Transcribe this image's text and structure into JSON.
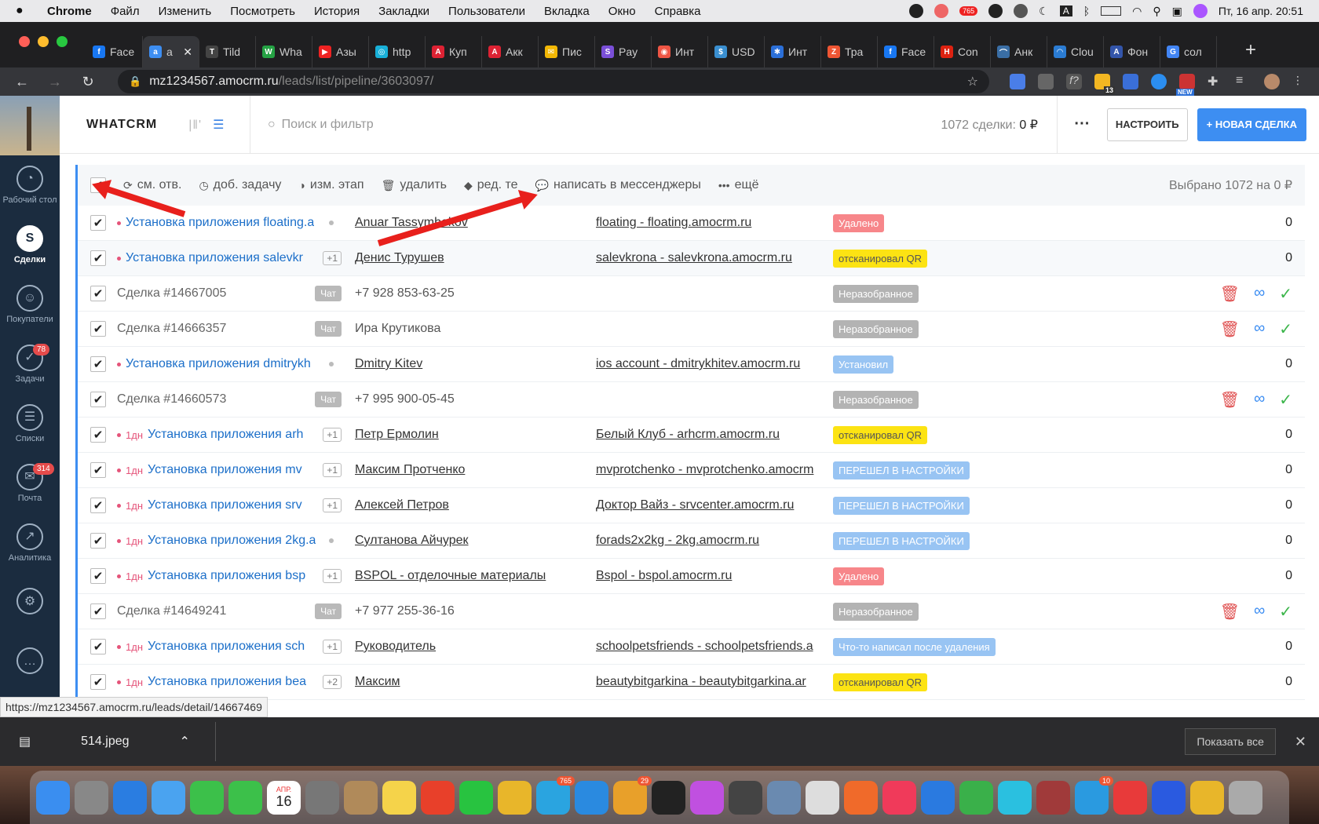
{
  "menubar": {
    "app": "Chrome",
    "items": [
      "Файл",
      "Изменить",
      "Посмотреть",
      "История",
      "Закладки",
      "Пользователи",
      "Вкладка",
      "Окно",
      "Справка"
    ],
    "badge": "765",
    "datetime": "Пт, 16 апр.  20:51"
  },
  "browser": {
    "tabs": [
      {
        "label": "Face",
        "color": "#1877f2",
        "glyph": "f"
      },
      {
        "label": "a",
        "color": "#3d8ef2",
        "glyph": "a",
        "active": true
      },
      {
        "label": "Tild",
        "color": "#444",
        "glyph": "T"
      },
      {
        "label": "Wha",
        "color": "#25a244",
        "glyph": "W"
      },
      {
        "label": "Азы",
        "color": "#e22",
        "glyph": "▶"
      },
      {
        "label": "http",
        "color": "#18b0d8",
        "glyph": "◎"
      },
      {
        "label": "Куп",
        "color": "#d23",
        "glyph": "A"
      },
      {
        "label": "Акк",
        "color": "#d23",
        "glyph": "A"
      },
      {
        "label": "Пис",
        "color": "#f2b705",
        "glyph": "✉"
      },
      {
        "label": "Pay",
        "color": "#7a4fd8",
        "glyph": "S"
      },
      {
        "label": "Инт",
        "color": "#e54",
        "glyph": "◉"
      },
      {
        "label": "USD",
        "color": "#3a8fd0",
        "glyph": "$"
      },
      {
        "label": "Инт",
        "color": "#2b6fd8",
        "glyph": "✱"
      },
      {
        "label": "Тра",
        "color": "#e53",
        "glyph": "Z"
      },
      {
        "label": "Face",
        "color": "#1877f2",
        "glyph": "f"
      },
      {
        "label": "Con",
        "color": "#d21",
        "glyph": "H"
      },
      {
        "label": "Анк",
        "color": "#3a6ea5",
        "glyph": "⌒"
      },
      {
        "label": "Clou",
        "color": "#2b7cd3",
        "glyph": "◠"
      },
      {
        "label": "Фон",
        "color": "#3355aa",
        "glyph": "A"
      },
      {
        "label": "сол",
        "color": "#4285f4",
        "glyph": "G"
      }
    ],
    "url_host": "mz1234567.amocrm.ru",
    "url_path": "/leads/list/pipeline/3603097/",
    "ext_badge_count": "13",
    "ext_badge_new": "NEW"
  },
  "leftnav": {
    "items": [
      {
        "label": "Рабочий стол",
        "icon": "dashboard-icon",
        "glyph": "◔"
      },
      {
        "label": "Сделки",
        "icon": "deals-icon",
        "glyph": "S",
        "active": true
      },
      {
        "label": "Покупатели",
        "icon": "customers-icon",
        "glyph": "☺"
      },
      {
        "label": "Задачи",
        "icon": "tasks-icon",
        "glyph": "✓",
        "badge": "78"
      },
      {
        "label": "Списки",
        "icon": "lists-icon",
        "glyph": "☰"
      },
      {
        "label": "Почта",
        "icon": "mail-icon",
        "glyph": "✉",
        "badge": "314"
      },
      {
        "label": "Аналитика",
        "icon": "analytics-icon",
        "glyph": "↗"
      },
      {
        "label": "",
        "icon": "settings-icon",
        "glyph": "⚙"
      },
      {
        "label": "",
        "icon": "chat-icon",
        "glyph": "…"
      }
    ]
  },
  "header": {
    "brand": "WHATCRM",
    "search_placeholder": "Поиск и фильтр",
    "count_label": "1072 сделки:",
    "count_value": "0 ₽",
    "more": "···",
    "setup_button": "НАСТРОИТЬ",
    "new_button": "+ НОВАЯ СДЕЛКА"
  },
  "toolbar": {
    "actions": [
      {
        "label": "см. отв.",
        "icon": "change-responsible-icon",
        "glyph": "⟳"
      },
      {
        "label": "доб. задачу",
        "icon": "add-task-icon",
        "glyph": "◷"
      },
      {
        "label": "изм. этап",
        "icon": "change-stage-icon",
        "glyph": "◑"
      },
      {
        "label": "удалить",
        "icon": "trash-icon",
        "glyph": "🗑"
      },
      {
        "label": "ред. те",
        "icon": "tag-icon",
        "glyph": "◆"
      },
      {
        "label": "написать в мессенджеры",
        "icon": "messenger-icon",
        "glyph": "💬"
      },
      {
        "label": "ещё",
        "icon": "more-icon",
        "glyph": "•••"
      }
    ],
    "selected": "Выбрано 1072 на 0 ₽"
  },
  "rows": [
    {
      "name": "Установка приложения floating.a",
      "dot": true,
      "age": "",
      "kind": "gdot",
      "contact": "Anuar Tassymbekov",
      "company": "floating - floating.amocrm.ru",
      "status": "Удалено",
      "status_class": "st-del",
      "budget": "0"
    },
    {
      "name": "Установка приложения salevkr",
      "dot": true,
      "age": "",
      "kind": "plus",
      "extra": "+1",
      "contact": "Денис Турушев",
      "company": "salevkrona - salevkrona.amocrm.ru",
      "status": "отсканировал QR",
      "status_class": "st-qr",
      "budget": "0"
    },
    {
      "name": "Сделка #14667005",
      "dot": false,
      "age": "",
      "kind": "chip",
      "extra": "Чат",
      "contact": "+7 928 853-63-25",
      "plain": true,
      "company": "",
      "status": "Неразобранное",
      "status_class": "st-unsorted",
      "actions": true
    },
    {
      "name": "Сделка #14666357",
      "dot": false,
      "age": "",
      "kind": "chip",
      "extra": "Чат",
      "contact": "Ира Крутикова",
      "plain": true,
      "company": "",
      "status": "Неразобранное",
      "status_class": "st-unsorted",
      "actions": true
    },
    {
      "name": "Установка приложения dmitrykh",
      "dot": true,
      "age": "",
      "kind": "gdot",
      "contact": "Dmitry Kitev",
      "company": "ios account - dmitrykhitev.amocrm.ru",
      "status": "Установил",
      "status_class": "st-inst",
      "budget": "0"
    },
    {
      "name": "Сделка #14660573",
      "dot": false,
      "age": "",
      "kind": "chip",
      "extra": "Чат",
      "contact": "+7 995 900-05-45",
      "plain": true,
      "company": "",
      "status": "Неразобранное",
      "status_class": "st-unsorted",
      "actions": true
    },
    {
      "name": "Установка приложения arh",
      "dot": true,
      "age": "1дн",
      "kind": "plus",
      "extra": "+1",
      "contact": "Петр Ермолин",
      "company": "Белый Клуб - arhcrm.amocrm.ru",
      "status": "отсканировал QR",
      "status_class": "st-qr",
      "budget": "0"
    },
    {
      "name": "Установка приложения mv",
      "dot": true,
      "age": "1дн",
      "kind": "plus",
      "extra": "+1",
      "contact": "Максим Протченко",
      "company": "mvprotchenko - mvprotchenko.amocrm",
      "status": "ПЕРЕШЕЛ В НАСТРОЙКИ",
      "status_class": "st-settings",
      "budget": "0"
    },
    {
      "name": "Установка приложения srv",
      "dot": true,
      "age": "1дн",
      "kind": "plus",
      "extra": "+1",
      "contact": "Алексей Петров",
      "company": "Доктор Вайз - srvcenter.amocrm.ru",
      "status": "ПЕРЕШЕЛ В НАСТРОЙКИ",
      "status_class": "st-settings",
      "budget": "0"
    },
    {
      "name": "Установка приложения 2kg.a",
      "dot": true,
      "age": "1дн",
      "kind": "gdot",
      "contact": "Султанова Айчурек",
      "company": "forads2x2kg - 2kg.amocrm.ru",
      "status": "ПЕРЕШЕЛ В НАСТРОЙКИ",
      "status_class": "st-settings",
      "budget": "0"
    },
    {
      "name": "Установка приложения bsp",
      "dot": true,
      "age": "1дн",
      "kind": "plus",
      "extra": "+1",
      "contact": "BSPOL - отделочные материалы",
      "company": "Bspol - bspol.amocrm.ru",
      "status": "Удалено",
      "status_class": "st-del",
      "budget": "0"
    },
    {
      "name": "Сделка #14649241",
      "dot": false,
      "age": "",
      "kind": "chip",
      "extra": "Чат",
      "contact": "+7 977 255-36-16",
      "plain": true,
      "company": "",
      "status": "Неразобранное",
      "status_class": "st-unsorted",
      "actions": true
    },
    {
      "name": "Установка приложения sch",
      "dot": true,
      "age": "1дн",
      "kind": "plus",
      "extra": "+1",
      "contact": "Руководитель",
      "company": "schoolpetsfriends - schoolpetsfriends.a",
      "status": "Что-то написал после удаления",
      "status_class": "st-settings",
      "budget": "0"
    },
    {
      "name": "Установка приложения bea",
      "dot": true,
      "age": "1дн",
      "kind": "plus",
      "extra": "+2",
      "contact": "Максим",
      "company": "beautybitgarkina - beautybitgarkina.ar",
      "status": "отсканировал QR",
      "status_class": "st-qr",
      "budget": "0"
    }
  ],
  "statusbar_url": "https://mz1234567.amocrm.ru/leads/detail/14667469",
  "download": {
    "file": "514.jpeg",
    "show_all": "Показать все"
  },
  "dock": {
    "calendar_month": "АПР.",
    "calendar_day": "16",
    "badges": {
      "telegram": "765",
      "mail": "29",
      "skype": "10"
    },
    "icons": [
      {
        "name": "finder-icon",
        "color": "#3a8ef0"
      },
      {
        "name": "launchpad-icon",
        "color": "#888"
      },
      {
        "name": "safari-icon",
        "color": "#2a7de1"
      },
      {
        "name": "mail-app-icon",
        "color": "#4aa3f0"
      },
      {
        "name": "facetime-icon",
        "color": "#3cc04a"
      },
      {
        "name": "messages-icon",
        "color": "#3cc04a"
      },
      {
        "name": "calendar-icon",
        "color": "#ffffff"
      },
      {
        "name": "system-preferences-icon",
        "color": "#777"
      },
      {
        "name": "contacts-icon",
        "color": "#b08a5a"
      },
      {
        "name": "notes-icon",
        "color": "#f5d34a"
      },
      {
        "name": "anydesk-icon",
        "color": "#e8402a"
      },
      {
        "name": "whatsapp-icon",
        "color": "#28c340"
      },
      {
        "name": "chrome-icon",
        "color": "#e8b62a"
      },
      {
        "name": "telegram-icon",
        "color": "#2aa4e0",
        "badge": "765"
      },
      {
        "name": "tasks-app-icon",
        "color": "#2a8ae0"
      },
      {
        "name": "bitrix-icon",
        "color": "#e8a02a",
        "badge": "29"
      },
      {
        "name": "terminal-icon",
        "color": "#222"
      },
      {
        "name": "affinity-icon",
        "color": "#c050e0"
      },
      {
        "name": "calculator-icon",
        "color": "#444"
      },
      {
        "name": "preview-icon",
        "color": "#6a8ab0"
      },
      {
        "name": "textedit-icon",
        "color": "#ddd"
      },
      {
        "name": "postman-icon",
        "color": "#f06a2a"
      },
      {
        "name": "music-icon",
        "color": "#f03a5a"
      },
      {
        "name": "maps-icon",
        "color": "#2a7ae0"
      },
      {
        "name": "numbers-icon",
        "color": "#3ab04a"
      },
      {
        "name": "bitrix24-icon",
        "color": "#2ac0e0"
      },
      {
        "name": "dictionary-icon",
        "color": "#a03a3a"
      },
      {
        "name": "skype-icon",
        "color": "#2a9ae0",
        "badge": "10"
      },
      {
        "name": "anydesk2-icon",
        "color": "#e83a3a"
      },
      {
        "name": "reeder-icon",
        "color": "#2a5ae0"
      },
      {
        "name": "chrome2-icon",
        "color": "#e8b62a"
      },
      {
        "name": "trash-dock-icon",
        "color": "#aaa"
      }
    ]
  }
}
